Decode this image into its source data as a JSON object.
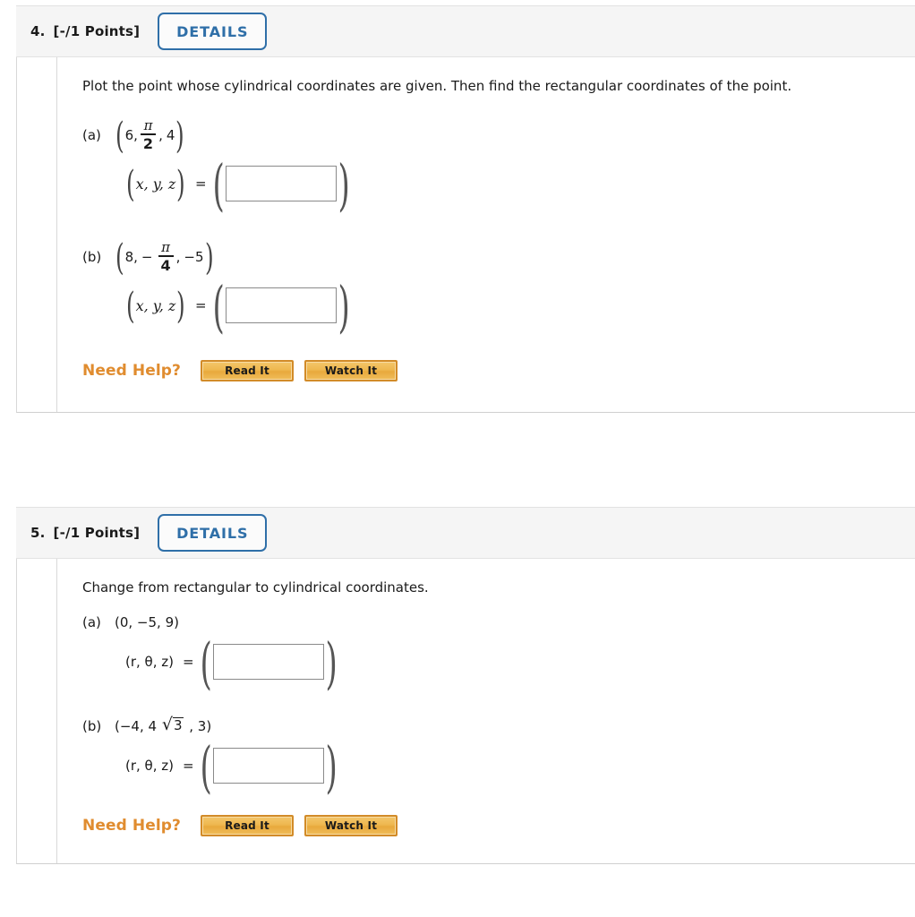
{
  "problems": [
    {
      "number": "4.",
      "points": "[-/1 Points]",
      "details_label": "DETAILS",
      "prompt": "Plot the point whose cylindrical coordinates are given. Then find the rectangular coordinates of the point.",
      "parts": [
        {
          "label": "(a)",
          "given": {
            "open_paren": "(",
            "first": "6,",
            "frac_numerator": "π",
            "frac_denominator": "2",
            "frac_trailing": ",",
            "last": "4",
            "close_paren": ")"
          },
          "answer": {
            "lhs_open": "(",
            "lhs_vars": "x, y, z",
            "lhs_close": ")",
            "equals": "=",
            "wrap_open": "(",
            "wrap_close": ")",
            "field_value": "",
            "field_placeholder": ""
          }
        },
        {
          "label": "(b)",
          "given": {
            "open_paren": "(",
            "first": "8,",
            "sign": "−",
            "frac_numerator": "π",
            "frac_denominator": "4",
            "frac_trailing": ",",
            "last": "−5",
            "close_paren": ")"
          },
          "answer": {
            "lhs_open": "(",
            "lhs_vars": "x, y, z",
            "lhs_close": ")",
            "equals": "=",
            "wrap_open": "(",
            "wrap_close": ")",
            "field_value": "",
            "field_placeholder": ""
          }
        }
      ],
      "need_help": {
        "label": "Need Help?",
        "read_it": "Read It",
        "watch_it": "Watch It"
      }
    },
    {
      "number": "5.",
      "points": "[-/1 Points]",
      "details_label": "DETAILS",
      "prompt": "Change from rectangular to cylindrical coordinates.",
      "parts": [
        {
          "label": "(a)",
          "given_plain": "(0, −5, 9)",
          "answer": {
            "lhs_plain": "(r, θ, z)",
            "equals": "=",
            "wrap_open": "(",
            "wrap_close": ")",
            "field_value": "",
            "field_placeholder": ""
          }
        },
        {
          "label": "(b)",
          "given_prefix": "(−4, 4",
          "given_sqrt_radicand": "3",
          "given_suffix": ", 3)",
          "answer": {
            "lhs_plain": "(r, θ, z)",
            "equals": "=",
            "wrap_open": "(",
            "wrap_close": ")",
            "field_value": "",
            "field_placeholder": ""
          }
        }
      ],
      "need_help": {
        "label": "Need Help?",
        "read_it": "Read It",
        "watch_it": "Watch It"
      }
    }
  ],
  "colors": {
    "header_bg": "#f5f5f5",
    "details_blue": "#2f6fa8",
    "need_help_orange": "#e08c2f",
    "help_button_border": "#d28b28"
  }
}
